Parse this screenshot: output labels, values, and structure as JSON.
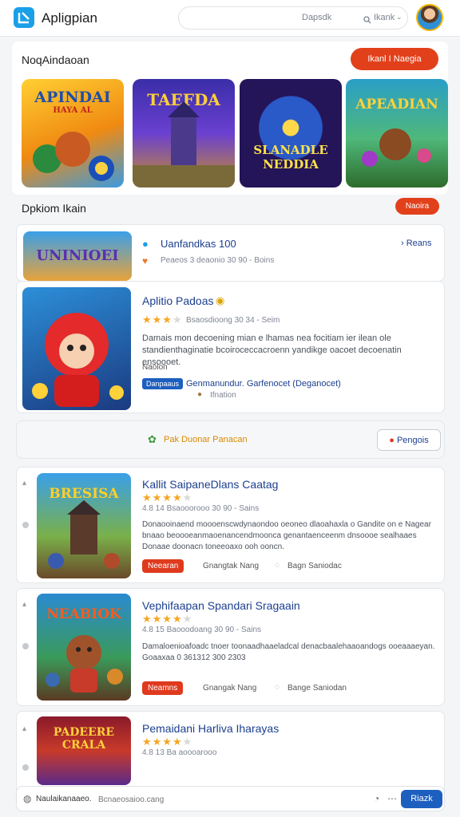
{
  "header": {
    "app_title": "Apligpian",
    "search_placeholder": "Dapsdk",
    "search_button": "Ikank"
  },
  "featured": {
    "title": "NoqAindaoan",
    "button": "Ikanl I Naegia",
    "tiles": [
      {
        "title": "APINDAI",
        "subtitle": "HAYA AL"
      },
      {
        "title": "TAEFDA",
        "subtitle": ""
      },
      {
        "title": "SLANADLE NEDDIA",
        "subtitle": ""
      },
      {
        "title": "APEADIAN",
        "subtitle": ""
      }
    ]
  },
  "section2": {
    "title": "Dpkiom Ikain",
    "button": "Naoira"
  },
  "list1": {
    "title": "Uanfandkas 100",
    "meta": "Peaeos 3 deaonio 30 90 - Boins",
    "link": "Reans",
    "thumb_title": "UNINIOEI"
  },
  "list2": {
    "title": "Aplitio Padoas",
    "meta": "Bsaosdioong 30 34 - Seim",
    "desc": "Damais mon decoening mian e lhamas nea focitiam ier ilean ole standienthaginatie bcoiroceccacroenn yandikge oacoet decoenatin ensoooet.",
    "label": "Naolon",
    "badge": "Danpaaus",
    "badge_note": "Genmanundur. Garfenocet (Deganocet)",
    "sub_note": "Ifnation"
  },
  "promo": {
    "text": "Pak   Duonar Panacan",
    "button": "Pengois"
  },
  "list3": {
    "title": "Kallit SaipaneDlans Caatag",
    "meta": "4.8   14 Bsaooorooo 30 90 - Sains",
    "desc": "Donaooinaend moooenscwdynaondoo oeoneo dlaoahaxla o Gandite on e Nagear bnaao beoooeanmaoenancendmoonca genantaenceenm dnsoooe sealhaaes Donaae doonacn toneeoaxo ooh ooncn.",
    "badge": "Neearan",
    "plain1": "Gnangtak Nang",
    "plain2": "Bagn Saniodac",
    "thumb_title": "BRESISA"
  },
  "list4": {
    "title": "Vephifaapan Spandari Sragaain",
    "meta": "4.8   15 Baooodoang 30 90 - Sains",
    "desc": "Damaloenioafoadc tnoer toonaadhaaeladcal denacbaalehaaoandogs ooeaaaeyan. Goaaxaa 0 361312 300 2303",
    "badge": "Neamns",
    "plain1": "Gnangak Nang",
    "plain2": "Bange Saniodan",
    "thumb_title": "NEABIOK"
  },
  "list5": {
    "title": "Pemaidani Harliva Iharayas",
    "meta": "4.8   13 Ba aoooarooo",
    "thumb_title": "PADEERE CRALA"
  },
  "bottom": {
    "label": "Naulaikanaaeo.",
    "placeholder": "Bcnaeosaioo.cang",
    "send": "Riazk"
  }
}
